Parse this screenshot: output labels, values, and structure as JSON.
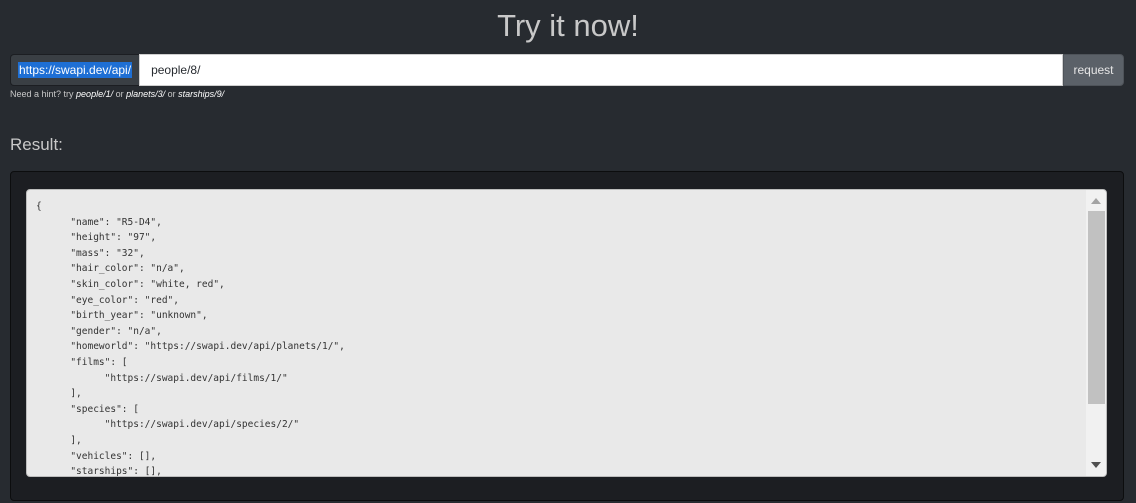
{
  "header": {
    "title": "Try it now!"
  },
  "request": {
    "prefix": "https://swapi.dev/api/",
    "path_value": "people/8/",
    "button_label": "request"
  },
  "hint": {
    "lead": "Need a hint? try ",
    "ex1": "people/1/",
    "sep1": " or ",
    "ex2": "planets/3/",
    "sep2": " or ",
    "ex3": "starships/9/"
  },
  "result": {
    "label": "Result:",
    "json_text": "{\n\t\"name\": \"R5-D4\",\n\t\"height\": \"97\",\n\t\"mass\": \"32\",\n\t\"hair_color\": \"n/a\",\n\t\"skin_color\": \"white, red\",\n\t\"eye_color\": \"red\",\n\t\"birth_year\": \"unknown\",\n\t\"gender\": \"n/a\",\n\t\"homeworld\": \"https://swapi.dev/api/planets/1/\",\n\t\"films\": [\n\t\t\"https://swapi.dev/api/films/1/\"\n\t],\n\t\"species\": [\n\t\t\"https://swapi.dev/api/species/2/\"\n\t],\n\t\"vehicles\": [],\n\t\"starships\": [],"
  },
  "colors": {
    "background": "#272b30",
    "prefix_highlight": "#1e6fd4",
    "button": "#5b6168",
    "well": "#1c1e22"
  },
  "icons": {
    "scroll_up": "chevron-up-icon",
    "scroll_down": "chevron-down-icon"
  }
}
